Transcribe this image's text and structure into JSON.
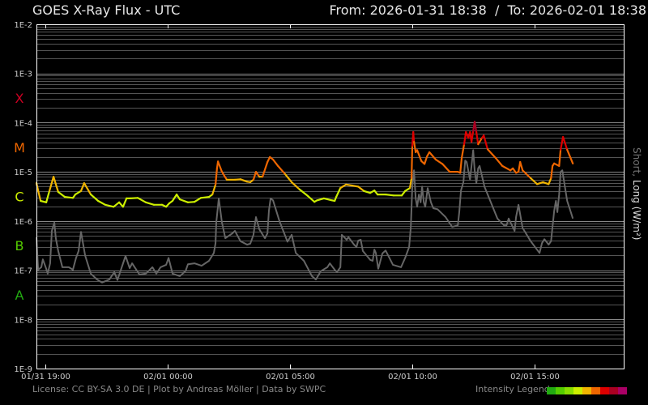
{
  "header": {
    "title": "GOES X-Ray Flux - UTC",
    "range": "From: 2026-01-31 18:38  /  To: 2026-02-01 18:38"
  },
  "footer": {
    "credits": "License: CC BY-SA 3.0 DE | Plot by Andreas Möller | Data by SWPC",
    "legend_label": "Intensity Legend",
    "legend_colors": [
      "#22aa11",
      "#55cc00",
      "#88dd00",
      "#ccee00",
      "#f0b400",
      "#ee6600",
      "#dd0000",
      "#aa0022",
      "#aa0066"
    ]
  },
  "chart_data": {
    "type": "line",
    "title": "GOES X-Ray Flux - UTC",
    "ylabel_short": "Short,",
    "ylabel_long": "Long (W/m²)",
    "x_units": "hours since 2026-01-31 18:38 UTC",
    "y_units": "log10 flux (W/m²)",
    "xlim": [
      0,
      24
    ],
    "ylim": [
      -9,
      -2
    ],
    "yscale": "log",
    "grid": true,
    "y_ticks": [
      {
        "value": -2,
        "label": "1E-2"
      },
      {
        "value": -3,
        "label": "1E-3"
      },
      {
        "value": -4,
        "label": "1E-4"
      },
      {
        "value": -5,
        "label": "1E-5"
      },
      {
        "value": -6,
        "label": "1E-6"
      },
      {
        "value": -7,
        "label": "1E-7"
      },
      {
        "value": -8,
        "label": "1E-8"
      },
      {
        "value": -9,
        "label": "1E-9"
      }
    ],
    "x_ticks": [
      {
        "value": 0.367,
        "label": "01/31 19:00"
      },
      {
        "value": 5.367,
        "label": "02/01 00:00"
      },
      {
        "value": 10.367,
        "label": "02/01 05:00"
      },
      {
        "value": 15.367,
        "label": "02/01 10:00"
      },
      {
        "value": 20.367,
        "label": "02/01 15:00"
      }
    ],
    "classes": [
      {
        "label": "X",
        "value": -3.5,
        "color": "#cc0022"
      },
      {
        "label": "M",
        "value": -4.5,
        "color": "#ee6600"
      },
      {
        "label": "C",
        "value": -5.5,
        "color": "#ccee00"
      },
      {
        "label": "B",
        "value": -6.5,
        "color": "#55cc00"
      },
      {
        "label": "A",
        "value": -7.5,
        "color": "#22aa11"
      }
    ],
    "series": [
      {
        "name": "Long",
        "points": [
          [
            0,
            -5.23
          ],
          [
            0.17,
            -5.59
          ],
          [
            0.4,
            -5.62
          ],
          [
            0.53,
            -5.39
          ],
          [
            0.7,
            -5.1
          ],
          [
            0.89,
            -5.41
          ],
          [
            1.16,
            -5.51
          ],
          [
            1.49,
            -5.53
          ],
          [
            1.59,
            -5.46
          ],
          [
            1.82,
            -5.39
          ],
          [
            1.95,
            -5.23
          ],
          [
            2.22,
            -5.46
          ],
          [
            2.52,
            -5.59
          ],
          [
            2.81,
            -5.67
          ],
          [
            3.15,
            -5.71
          ],
          [
            3.38,
            -5.62
          ],
          [
            3.54,
            -5.71
          ],
          [
            3.68,
            -5.54
          ],
          [
            3.84,
            -5.54
          ],
          [
            4.14,
            -5.53
          ],
          [
            4.47,
            -5.62
          ],
          [
            4.8,
            -5.67
          ],
          [
            5.13,
            -5.67
          ],
          [
            5.3,
            -5.71
          ],
          [
            5.43,
            -5.64
          ],
          [
            5.56,
            -5.59
          ],
          [
            5.73,
            -5.46
          ],
          [
            5.86,
            -5.56
          ],
          [
            6.19,
            -5.62
          ],
          [
            6.46,
            -5.61
          ],
          [
            6.72,
            -5.53
          ],
          [
            7.05,
            -5.51
          ],
          [
            7.19,
            -5.46
          ],
          [
            7.32,
            -5.26
          ],
          [
            7.38,
            -4.93
          ],
          [
            7.42,
            -4.79
          ],
          [
            7.58,
            -5.0
          ],
          [
            7.78,
            -5.16
          ],
          [
            8.11,
            -5.16
          ],
          [
            8.34,
            -5.15
          ],
          [
            8.61,
            -5.2
          ],
          [
            8.74,
            -5.21
          ],
          [
            8.87,
            -5.16
          ],
          [
            8.97,
            -5.0
          ],
          [
            9.11,
            -5.1
          ],
          [
            9.24,
            -5.1
          ],
          [
            9.44,
            -4.8
          ],
          [
            9.54,
            -4.7
          ],
          [
            9.67,
            -4.75
          ],
          [
            9.87,
            -4.88
          ],
          [
            10.17,
            -5.05
          ],
          [
            10.43,
            -5.21
          ],
          [
            10.76,
            -5.36
          ],
          [
            11.09,
            -5.49
          ],
          [
            11.36,
            -5.61
          ],
          [
            11.46,
            -5.58
          ],
          [
            11.75,
            -5.54
          ],
          [
            12.09,
            -5.58
          ],
          [
            12.19,
            -5.59
          ],
          [
            12.25,
            -5.51
          ],
          [
            12.42,
            -5.33
          ],
          [
            12.65,
            -5.26
          ],
          [
            12.91,
            -5.28
          ],
          [
            13.15,
            -5.3
          ],
          [
            13.38,
            -5.39
          ],
          [
            13.64,
            -5.43
          ],
          [
            13.81,
            -5.38
          ],
          [
            13.94,
            -5.46
          ],
          [
            14.27,
            -5.46
          ],
          [
            14.6,
            -5.48
          ],
          [
            14.93,
            -5.48
          ],
          [
            15.07,
            -5.39
          ],
          [
            15.26,
            -5.33
          ],
          [
            15.33,
            -5.13
          ],
          [
            15.36,
            -4.47
          ],
          [
            15.4,
            -4.19
          ],
          [
            15.43,
            -4.39
          ],
          [
            15.5,
            -4.6
          ],
          [
            15.56,
            -4.56
          ],
          [
            15.73,
            -4.78
          ],
          [
            15.86,
            -4.84
          ],
          [
            15.96,
            -4.69
          ],
          [
            16.06,
            -4.6
          ],
          [
            16.32,
            -4.75
          ],
          [
            16.59,
            -4.84
          ],
          [
            16.89,
            -5.0
          ],
          [
            17.22,
            -5.0
          ],
          [
            17.32,
            -5.02
          ],
          [
            17.38,
            -4.72
          ],
          [
            17.48,
            -4.44
          ],
          [
            17.55,
            -4.19
          ],
          [
            17.65,
            -4.31
          ],
          [
            17.72,
            -4.19
          ],
          [
            17.78,
            -4.39
          ],
          [
            17.85,
            -4.17
          ],
          [
            17.91,
            -3.98
          ],
          [
            17.98,
            -4.19
          ],
          [
            18.05,
            -4.44
          ],
          [
            18.21,
            -4.31
          ],
          [
            18.28,
            -4.26
          ],
          [
            18.44,
            -4.54
          ],
          [
            18.77,
            -4.72
          ],
          [
            19.04,
            -4.88
          ],
          [
            19.37,
            -4.97
          ],
          [
            19.47,
            -4.93
          ],
          [
            19.6,
            -5.02
          ],
          [
            19.7,
            -5.0
          ],
          [
            19.77,
            -4.8
          ],
          [
            19.87,
            -4.97
          ],
          [
            20.2,
            -5.13
          ],
          [
            20.46,
            -5.25
          ],
          [
            20.7,
            -5.21
          ],
          [
            20.93,
            -5.25
          ],
          [
            21.03,
            -5.13
          ],
          [
            21.09,
            -4.88
          ],
          [
            21.16,
            -4.83
          ],
          [
            21.36,
            -4.88
          ],
          [
            21.42,
            -4.55
          ],
          [
            21.52,
            -4.29
          ],
          [
            21.69,
            -4.55
          ],
          [
            21.92,
            -4.83
          ]
        ]
      },
      {
        "name": "Short",
        "color": "#666666",
        "points": [
          [
            0,
            -6.33
          ],
          [
            0.07,
            -6.99
          ],
          [
            0.2,
            -6.94
          ],
          [
            0.26,
            -6.78
          ],
          [
            0.4,
            -6.97
          ],
          [
            0.46,
            -7.07
          ],
          [
            0.56,
            -6.86
          ],
          [
            0.63,
            -6.2
          ],
          [
            0.73,
            -6.03
          ],
          [
            0.79,
            -6.35
          ],
          [
            0.89,
            -6.61
          ],
          [
            1.06,
            -6.94
          ],
          [
            1.32,
            -6.94
          ],
          [
            1.49,
            -6.99
          ],
          [
            1.62,
            -6.75
          ],
          [
            1.72,
            -6.61
          ],
          [
            1.82,
            -6.22
          ],
          [
            1.99,
            -6.7
          ],
          [
            2.22,
            -7.07
          ],
          [
            2.48,
            -7.19
          ],
          [
            2.68,
            -7.25
          ],
          [
            2.98,
            -7.19
          ],
          [
            3.18,
            -7.04
          ],
          [
            3.31,
            -7.2
          ],
          [
            3.64,
            -6.71
          ],
          [
            3.81,
            -6.96
          ],
          [
            3.91,
            -6.86
          ],
          [
            4.21,
            -7.09
          ],
          [
            4.47,
            -7.07
          ],
          [
            4.74,
            -6.94
          ],
          [
            4.9,
            -7.07
          ],
          [
            5.07,
            -6.94
          ],
          [
            5.3,
            -6.89
          ],
          [
            5.4,
            -6.75
          ],
          [
            5.56,
            -7.07
          ],
          [
            5.86,
            -7.12
          ],
          [
            6.09,
            -7.02
          ],
          [
            6.19,
            -6.88
          ],
          [
            6.46,
            -6.86
          ],
          [
            6.75,
            -6.91
          ],
          [
            7.05,
            -6.81
          ],
          [
            7.25,
            -6.65
          ],
          [
            7.32,
            -6.45
          ],
          [
            7.35,
            -6.03
          ],
          [
            7.45,
            -5.54
          ],
          [
            7.58,
            -6.03
          ],
          [
            7.72,
            -6.35
          ],
          [
            8.01,
            -6.25
          ],
          [
            8.11,
            -6.2
          ],
          [
            8.34,
            -6.41
          ],
          [
            8.61,
            -6.48
          ],
          [
            8.74,
            -6.46
          ],
          [
            8.87,
            -6.28
          ],
          [
            8.97,
            -5.92
          ],
          [
            9.11,
            -6.17
          ],
          [
            9.34,
            -6.35
          ],
          [
            9.44,
            -6.25
          ],
          [
            9.5,
            -5.79
          ],
          [
            9.57,
            -5.54
          ],
          [
            9.67,
            -5.58
          ],
          [
            9.93,
            -6.0
          ],
          [
            10.26,
            -6.42
          ],
          [
            10.43,
            -6.28
          ],
          [
            10.6,
            -6.65
          ],
          [
            10.93,
            -6.81
          ],
          [
            11.26,
            -7.12
          ],
          [
            11.42,
            -7.19
          ],
          [
            11.62,
            -7.02
          ],
          [
            11.89,
            -6.94
          ],
          [
            11.99,
            -6.86
          ],
          [
            12.19,
            -6.99
          ],
          [
            12.28,
            -7.04
          ],
          [
            12.42,
            -6.94
          ],
          [
            12.48,
            -6.28
          ],
          [
            12.68,
            -6.38
          ],
          [
            12.75,
            -6.33
          ],
          [
            12.98,
            -6.48
          ],
          [
            13.08,
            -6.53
          ],
          [
            13.15,
            -6.4
          ],
          [
            13.25,
            -6.38
          ],
          [
            13.34,
            -6.61
          ],
          [
            13.64,
            -6.79
          ],
          [
            13.74,
            -6.81
          ],
          [
            13.81,
            -6.58
          ],
          [
            13.87,
            -6.65
          ],
          [
            13.97,
            -6.97
          ],
          [
            14.14,
            -6.66
          ],
          [
            14.27,
            -6.6
          ],
          [
            14.57,
            -6.89
          ],
          [
            14.9,
            -6.94
          ],
          [
            15.07,
            -6.75
          ],
          [
            15.23,
            -6.53
          ],
          [
            15.3,
            -6.12
          ],
          [
            15.36,
            -5.3
          ],
          [
            15.43,
            -4.97
          ],
          [
            15.5,
            -5.54
          ],
          [
            15.56,
            -5.71
          ],
          [
            15.63,
            -5.46
          ],
          [
            15.7,
            -5.62
          ],
          [
            15.76,
            -5.3
          ],
          [
            15.83,
            -5.62
          ],
          [
            15.89,
            -5.71
          ],
          [
            15.99,
            -5.33
          ],
          [
            16.12,
            -5.62
          ],
          [
            16.22,
            -5.74
          ],
          [
            16.39,
            -5.76
          ],
          [
            16.72,
            -5.92
          ],
          [
            16.99,
            -6.12
          ],
          [
            17.22,
            -6.09
          ],
          [
            17.28,
            -5.82
          ],
          [
            17.35,
            -5.38
          ],
          [
            17.45,
            -5.21
          ],
          [
            17.52,
            -4.77
          ],
          [
            17.58,
            -4.8
          ],
          [
            17.72,
            -5.16
          ],
          [
            17.85,
            -4.56
          ],
          [
            17.91,
            -4.97
          ],
          [
            17.98,
            -5.23
          ],
          [
            18.05,
            -4.93
          ],
          [
            18.11,
            -4.88
          ],
          [
            18.31,
            -5.3
          ],
          [
            18.61,
            -5.67
          ],
          [
            18.84,
            -5.95
          ],
          [
            19.11,
            -6.09
          ],
          [
            19.21,
            -6.09
          ],
          [
            19.3,
            -5.95
          ],
          [
            19.54,
            -6.2
          ],
          [
            19.6,
            -5.92
          ],
          [
            19.7,
            -5.67
          ],
          [
            19.87,
            -6.14
          ],
          [
            20.2,
            -6.41
          ],
          [
            20.56,
            -6.65
          ],
          [
            20.66,
            -6.45
          ],
          [
            20.76,
            -6.37
          ],
          [
            20.93,
            -6.48
          ],
          [
            21.03,
            -6.41
          ],
          [
            21.16,
            -5.79
          ],
          [
            21.23,
            -5.59
          ],
          [
            21.29,
            -5.82
          ],
          [
            21.36,
            -5.46
          ],
          [
            21.42,
            -5.0
          ],
          [
            21.49,
            -4.97
          ],
          [
            21.69,
            -5.59
          ],
          [
            21.85,
            -5.84
          ],
          [
            21.92,
            -5.95
          ]
        ]
      }
    ]
  }
}
